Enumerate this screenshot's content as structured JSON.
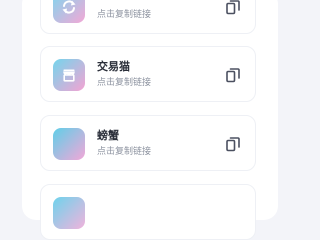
{
  "items": [
    {
      "name": "",
      "hint": "点击复制链接",
      "icon": "refresh-icon",
      "gradient": [
        "#7fd6ee",
        "#f3a8d6"
      ]
    },
    {
      "name": "交易猫",
      "hint": "点击复制链接",
      "icon": "shop-icon",
      "gradient": [
        "#74d5ec",
        "#f4a3d3"
      ]
    },
    {
      "name": "螃蟹",
      "hint": "点击复制链接",
      "icon": "",
      "gradient": [
        "#5fcfe8",
        "#f2a7d8"
      ]
    },
    {
      "name": "",
      "hint": "",
      "icon": "",
      "gradient": [
        "#6ed3ec",
        "#f1b3dc"
      ]
    }
  ],
  "colors": {
    "copy_icon": "#4b5060"
  }
}
